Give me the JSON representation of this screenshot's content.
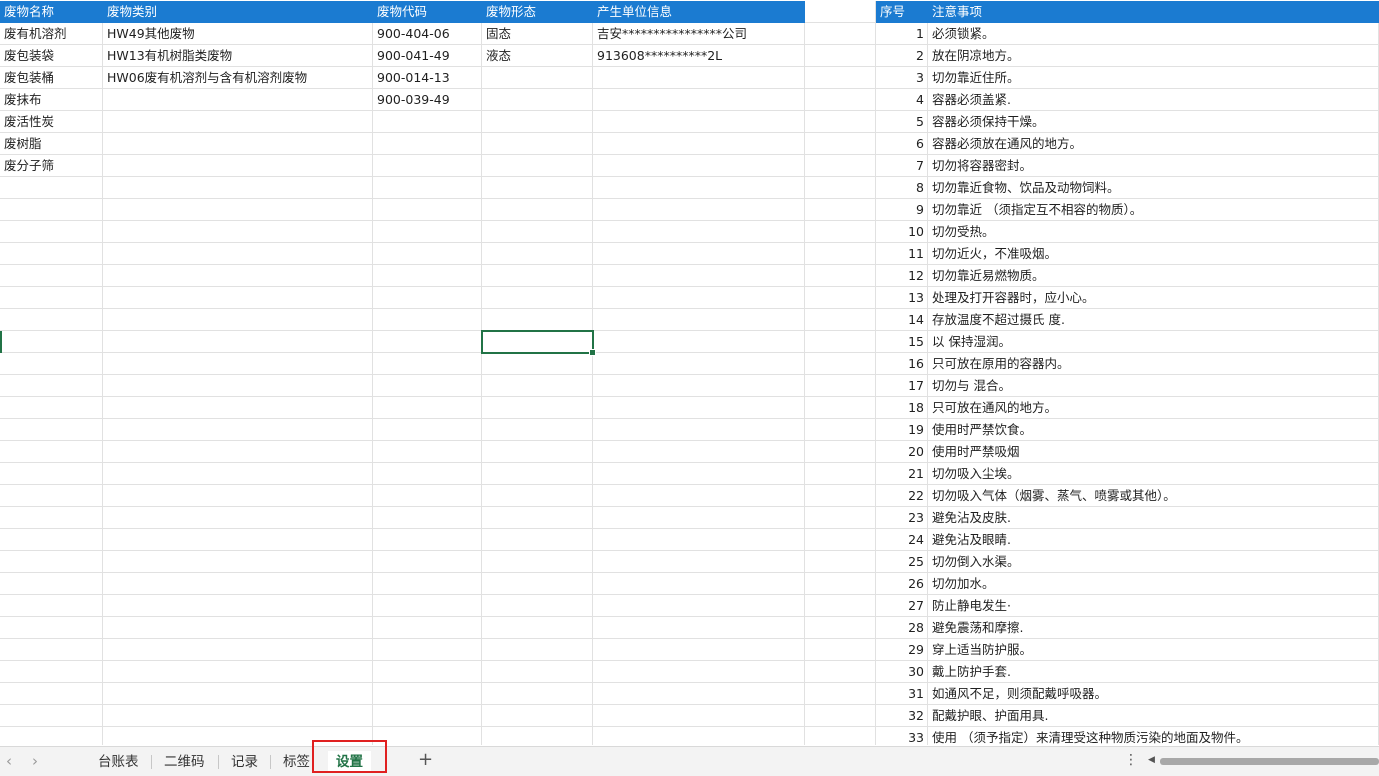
{
  "headers": [
    "废物名称",
    "废物类别",
    "废物代码",
    "废物形态",
    "产生单位信息",
    "",
    "序号",
    "注意事项"
  ],
  "waste_rows": [
    [
      "废有机溶剂",
      "HW49其他废物",
      "900-404-06",
      "固态",
      "吉安****************公司"
    ],
    [
      "废包装袋",
      "HW13有机树脂类废物",
      "900-041-49",
      "液态",
      "913608**********2L"
    ],
    [
      "废包装桶",
      "HW06废有机溶剂与含有机溶剂废物",
      "900-014-13",
      "",
      ""
    ],
    [
      "废抹布",
      "",
      "900-039-49",
      "",
      ""
    ],
    [
      "废活性炭",
      "",
      "",
      "",
      ""
    ],
    [
      "废树脂",
      "",
      "",
      "",
      ""
    ],
    [
      "废分子筛",
      "",
      "",
      "",
      ""
    ]
  ],
  "notes": [
    {
      "no": "1",
      "text": "必须锁紧。"
    },
    {
      "no": "2",
      "text": "放在阴凉地方。"
    },
    {
      "no": "3",
      "text": "切勿靠近住所。"
    },
    {
      "no": "4",
      "text": "容器必须盖紧."
    },
    {
      "no": "5",
      "text": "容器必须保持干燥。"
    },
    {
      "no": "6",
      "text": "容器必须放在通风的地方。"
    },
    {
      "no": "7",
      "text": "切勿将容器密封。"
    },
    {
      "no": "8",
      "text": "切勿靠近食物、饮品及动物饲料。"
    },
    {
      "no": "9",
      "text": "切勿靠近 （须指定互不相容的物质）。"
    },
    {
      "no": "10",
      "text": "切勿受热。"
    },
    {
      "no": "11",
      "text": "切勿近火，不准吸烟。"
    },
    {
      "no": "12",
      "text": "切勿靠近易燃物质。"
    },
    {
      "no": "13",
      "text": "处理及打开容器时，应小心。"
    },
    {
      "no": "14",
      "text": "存放温度不超过摄氏 度."
    },
    {
      "no": "15",
      "text": "以 保持湿润。"
    },
    {
      "no": "16",
      "text": "只可放在原用的容器内。"
    },
    {
      "no": "17",
      "text": "切勿与 混合。"
    },
    {
      "no": "18",
      "text": "只可放在通风的地方。"
    },
    {
      "no": "19",
      "text": "使用时严禁饮食。"
    },
    {
      "no": "20",
      "text": "使用时严禁吸烟"
    },
    {
      "no": "21",
      "text": "切勿吸入尘埃。"
    },
    {
      "no": "22",
      "text": "切勿吸入气体（烟雾、蒸气、喷雾或其他）。"
    },
    {
      "no": "23",
      "text": "避免沾及皮肤."
    },
    {
      "no": "24",
      "text": "避免沾及眼睛."
    },
    {
      "no": "25",
      "text": "切勿倒入水渠。"
    },
    {
      "no": "26",
      "text": "切勿加水。"
    },
    {
      "no": "27",
      "text": "防止静电发生·"
    },
    {
      "no": "28",
      "text": "避免震荡和摩擦."
    },
    {
      "no": "29",
      "text": "穿上适当防护服。"
    },
    {
      "no": "30",
      "text": "戴上防护手套."
    },
    {
      "no": "31",
      "text": "如通风不足，则须配戴呼吸器。"
    },
    {
      "no": "32",
      "text": "配戴护眼、护面用具."
    },
    {
      "no": "33",
      "text": "使用 （须予指定）来清理受这种物质污染的地面及物件。"
    }
  ],
  "tabs": [
    "台账表",
    "二维码",
    "记录",
    "标签",
    "设置"
  ],
  "active_tab": "设置",
  "nav": {
    "prev": "‹",
    "next": "›",
    "add": "+",
    "more": "⋮",
    "scroll_left": "◀"
  },
  "colors": {
    "header_bg": "#1b7bd1",
    "selection": "#217346",
    "highlight": "#e02020"
  }
}
